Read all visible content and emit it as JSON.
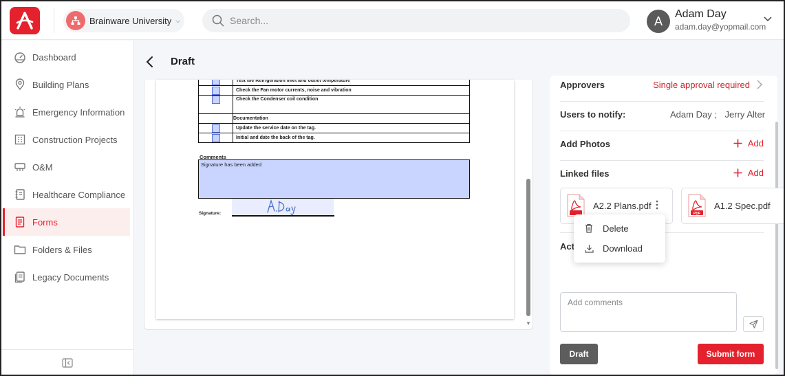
{
  "header": {
    "org_name": "Brainware University",
    "search_placeholder": "Search...",
    "user": {
      "initial": "A",
      "name": "Adam Day",
      "email": "adam.day@yopmail.com"
    }
  },
  "sidebar": {
    "items": [
      {
        "label": "Dashboard",
        "icon": "dashboard-icon"
      },
      {
        "label": "Building Plans",
        "icon": "location-pin-icon"
      },
      {
        "label": "Emergency Information",
        "icon": "alarm-icon"
      },
      {
        "label": "Construction Projects",
        "icon": "building-icon"
      },
      {
        "label": "O&M",
        "icon": "hvac-icon"
      },
      {
        "label": "Healthcare Compliance",
        "icon": "notebook-icon"
      },
      {
        "label": "Forms",
        "icon": "form-icon",
        "active": true
      },
      {
        "label": "Folders & Files",
        "icon": "folder-icon"
      },
      {
        "label": "Legacy Documents",
        "icon": "documents-icon"
      }
    ]
  },
  "page": {
    "title": "Draft"
  },
  "document": {
    "rows": [
      {
        "text": "Test the Refrigeration inlet and outlet temperature",
        "checkbox": true
      },
      {
        "text": "Check the Fan motor currents, noise and vibration",
        "checkbox": true
      },
      {
        "text": "Check the Condenser coil condition",
        "checkbox": true
      },
      {
        "text": "Documentation",
        "checkbox": false,
        "section": true
      },
      {
        "text": "Update the service date on the tag.",
        "checkbox": true
      },
      {
        "text": "Initial and date the back of the tag.",
        "checkbox": true
      }
    ],
    "comments_label": "Comments",
    "comments_text": "Signature has been added",
    "signature_label": "Signature:",
    "signature_text": "A.Day"
  },
  "panel": {
    "approvers_label": "Approvers",
    "approvers_value": "Single approval required",
    "notify_label": "Users to notify:",
    "notify_users": [
      "Adam Day ;",
      "Jerry Alter"
    ],
    "add_photos_label": "Add Photos",
    "linked_files_label": "Linked files",
    "add_label": "Add",
    "files": [
      {
        "name": "A2.2 Plans.pdf",
        "type": "PDF"
      },
      {
        "name": "A1.2 Spec.pdf",
        "type": "PDF"
      }
    ],
    "file_menu": {
      "delete": "Delete",
      "download": "Download"
    },
    "activity_label": "Act",
    "comment_placeholder": "Add comments",
    "draft_button": "Draft",
    "submit_button": "Submit form"
  },
  "colors": {
    "brand": "#e4212d",
    "approval": "#c8252d",
    "highlight": "#c9d4ff"
  }
}
